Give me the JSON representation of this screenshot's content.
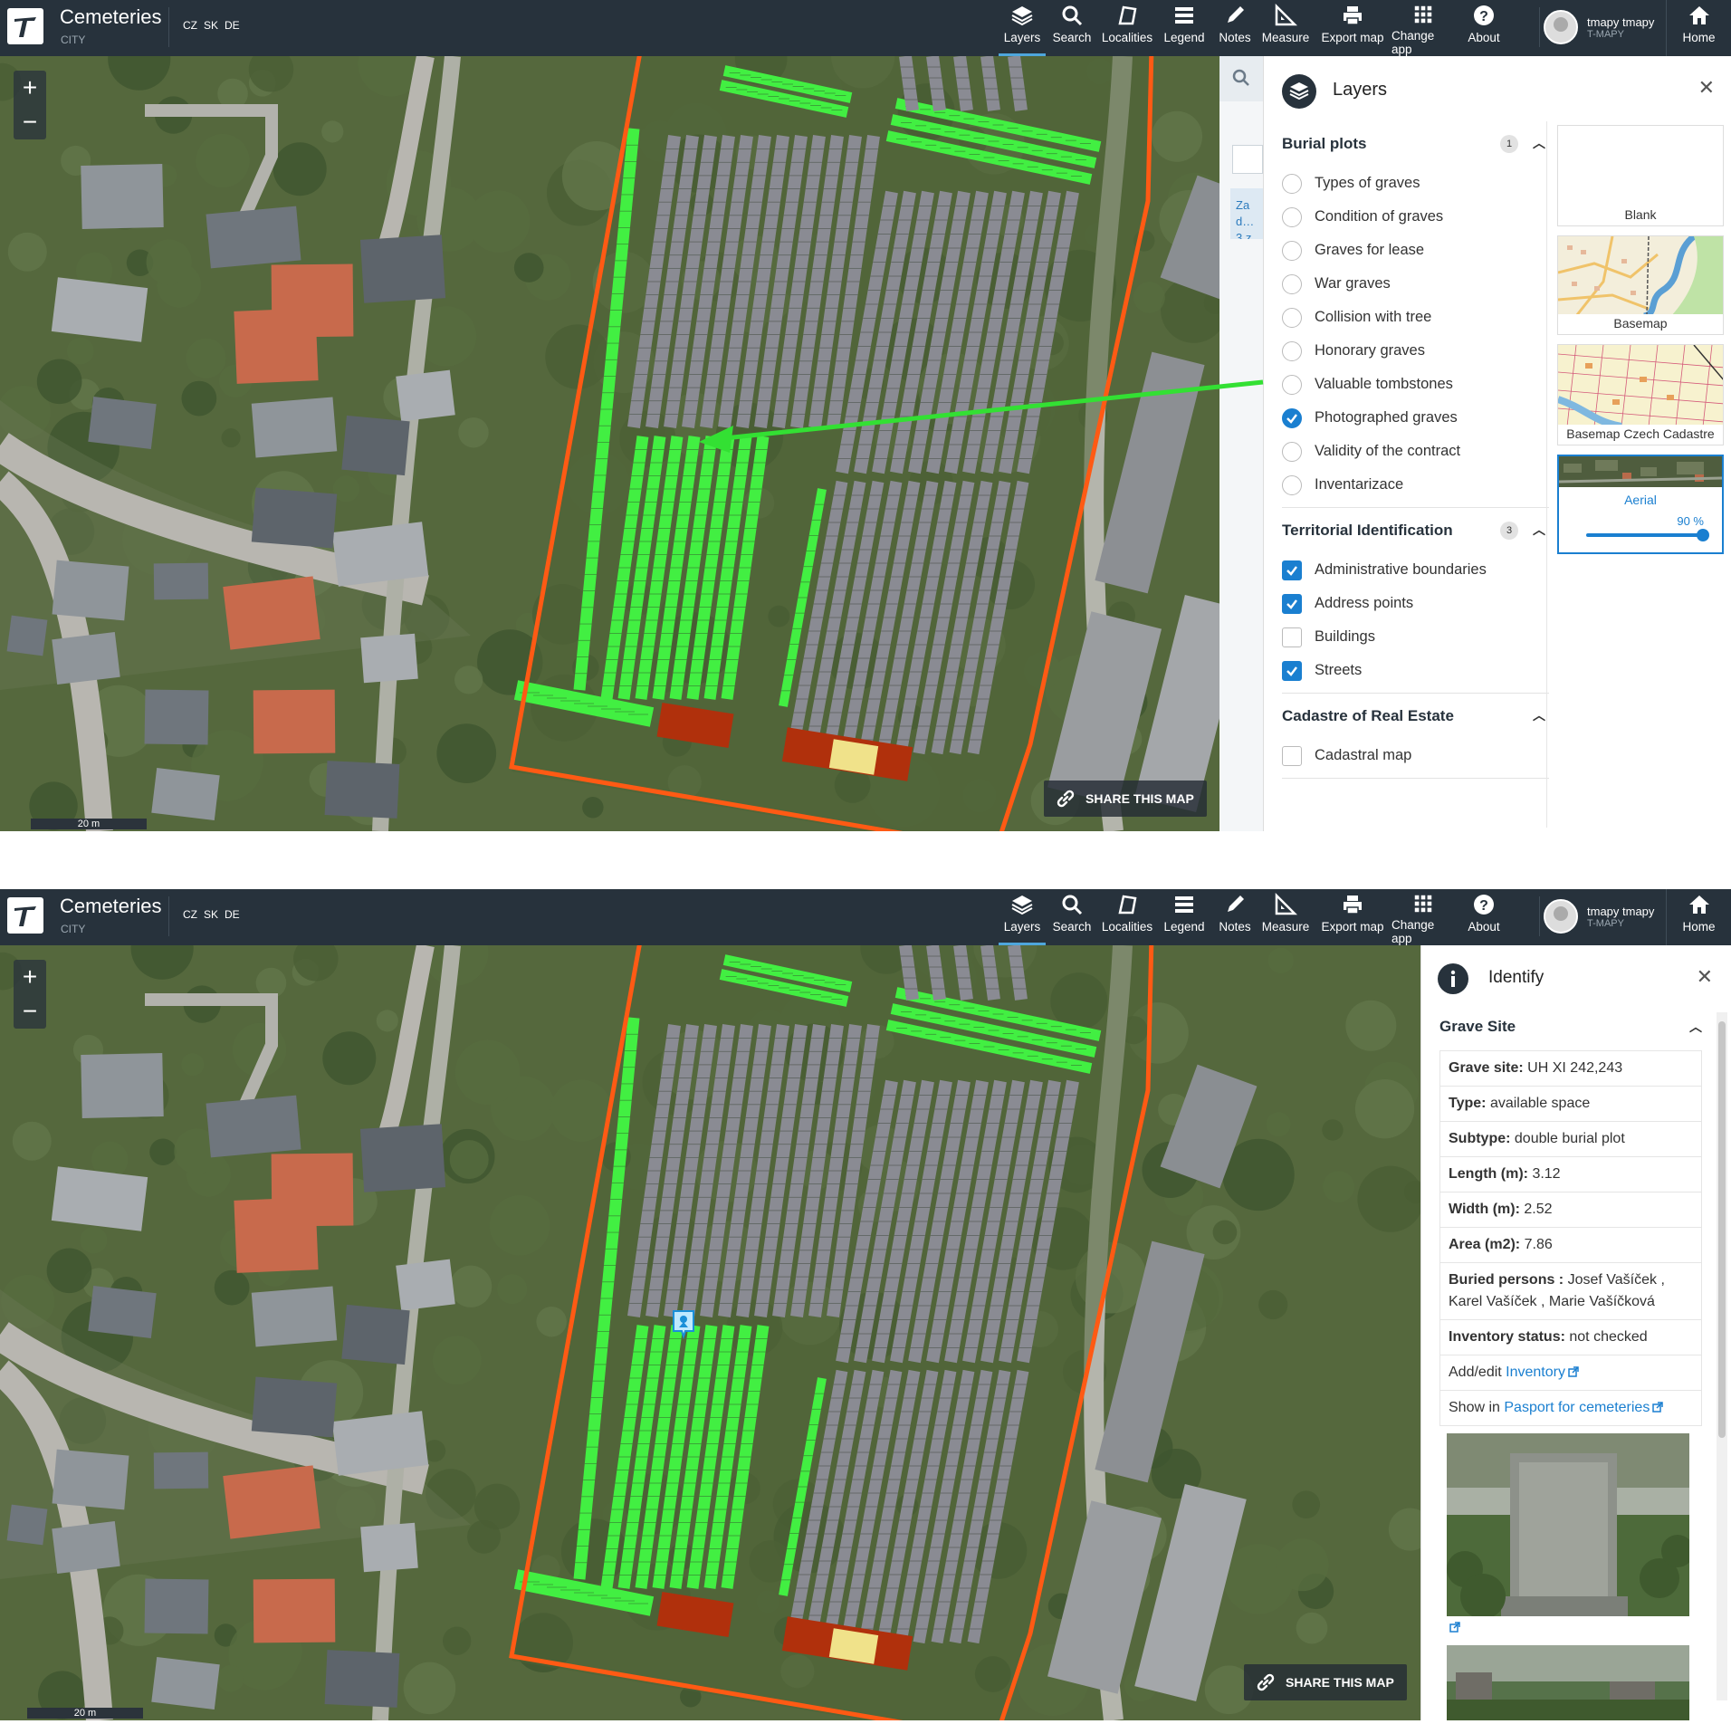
{
  "app": {
    "title": "Cemeteries",
    "subtitle": "CITY",
    "languages": [
      "CZ",
      "SK",
      "DE"
    ]
  },
  "toolbar": {
    "items": [
      {
        "label": "Layers",
        "icon": "layers-icon"
      },
      {
        "label": "Search",
        "icon": "search-icon"
      },
      {
        "label": "Localities",
        "icon": "localities-icon"
      },
      {
        "label": "Legend",
        "icon": "legend-icon"
      },
      {
        "label": "Notes",
        "icon": "pencil-icon"
      },
      {
        "label": "Measure",
        "icon": "measure-icon"
      },
      {
        "label": "Export map",
        "icon": "printer-icon"
      },
      {
        "label": "Change app",
        "icon": "grid-icon"
      },
      {
        "label": "About",
        "icon": "help-icon"
      }
    ],
    "active": "Layers"
  },
  "user": {
    "name": "tmapy tmapy",
    "org": "T-MAPY"
  },
  "home_label": "Home",
  "map": {
    "scale_label": "20 m",
    "share_label": "SHARE THIS MAP",
    "zoom_in": "+",
    "zoom_out": "−",
    "behind_text": "Zad… 3 zn…"
  },
  "layers_panel": {
    "title": "Layers",
    "groups": [
      {
        "name": "Burial plots",
        "count": "1",
        "type": "radio",
        "items": [
          {
            "label": "Types of graves",
            "checked": false
          },
          {
            "label": "Condition of graves",
            "checked": false
          },
          {
            "label": "Graves for lease",
            "checked": false
          },
          {
            "label": "War graves",
            "checked": false
          },
          {
            "label": "Collision with tree",
            "checked": false
          },
          {
            "label": "Honorary graves",
            "checked": false
          },
          {
            "label": "Valuable tombstones",
            "checked": false
          },
          {
            "label": "Photographed graves",
            "checked": true
          },
          {
            "label": "Validity of the contract",
            "checked": false
          },
          {
            "label": "Inventarizace",
            "checked": false
          }
        ]
      },
      {
        "name": "Territorial Identification",
        "count": "3",
        "type": "checkbox",
        "items": [
          {
            "label": "Administrative boundaries",
            "checked": true
          },
          {
            "label": "Address points",
            "checked": true
          },
          {
            "label": "Buildings",
            "checked": false
          },
          {
            "label": "Streets",
            "checked": true
          }
        ]
      },
      {
        "name": "Cadastre of Real Estate",
        "count": "",
        "type": "checkbox",
        "items": [
          {
            "label": "Cadastral map",
            "checked": false
          }
        ]
      }
    ],
    "basemaps": [
      {
        "label": "Blank",
        "selected": false
      },
      {
        "label": "Basemap",
        "selected": false
      },
      {
        "label": "Basemap Czech Cadastre",
        "selected": false
      },
      {
        "label": "Aerial",
        "selected": true,
        "opacity": "90 %"
      }
    ]
  },
  "identify_panel": {
    "title": "Identify",
    "section": "Grave Site",
    "rows": [
      {
        "label": "Grave site:",
        "value": "UH XI 242,243"
      },
      {
        "label": "Type:",
        "value": "available space"
      },
      {
        "label": "Subtype:",
        "value": "double burial plot"
      },
      {
        "label": "Length (m):",
        "value": "3.12"
      },
      {
        "label": "Width (m):",
        "value": "2.52"
      },
      {
        "label": "Area (m2):",
        "value": "7.86"
      },
      {
        "label": "Buried persons :",
        "value": "Josef Vašíček , Karel Vašíček , Marie Vašíčková"
      },
      {
        "label": "Inventory status:",
        "value": "not checked"
      }
    ],
    "inventory_prefix": "Add/edit ",
    "inventory_link": "Inventory",
    "pasport_prefix": "Show in ",
    "pasport_link": "Pasport for cemeteries"
  },
  "colors": {
    "topbar": "#27323c",
    "accent": "#1a7fd0",
    "plot_green": "#44ee44",
    "boundary": "#ff5a14"
  }
}
